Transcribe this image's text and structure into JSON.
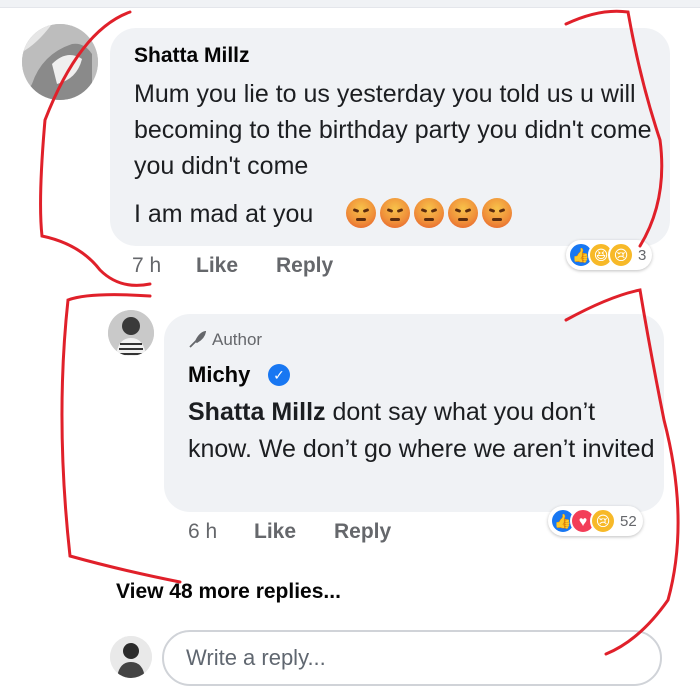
{
  "comment": {
    "author": "Shatta Millz",
    "text": "Mum you lie to us yesterday you told us u will becoming to the birthday party you didn't come you didn't come",
    "last_line": "I am mad at you",
    "inline_emojis": [
      "angry-emoji",
      "angry-emoji",
      "angry-emoji",
      "angry-emoji",
      "angry-emoji"
    ],
    "time": "7 h",
    "like_label": "Like",
    "reply_label": "Reply",
    "reactions": [
      "like",
      "haha",
      "sad"
    ],
    "reaction_count": "3"
  },
  "reply": {
    "badge": "Author",
    "author": "Michy",
    "mention": "Shatta Millz",
    "text": " dont say what you don’t know. We don’t go where we aren’t invited",
    "time": "6 h",
    "like_label": "Like",
    "reply_label": "Reply",
    "reactions": [
      "like",
      "love",
      "sad"
    ],
    "reaction_count": "52"
  },
  "view_more": "View 48 more replies...",
  "composer": {
    "placeholder": "Write a reply..."
  },
  "colors": {
    "bubble_bg": "#f0f2f5",
    "meta_text": "#65676b",
    "like_blue": "#1877f2",
    "annotation_red": "#e0202a"
  }
}
